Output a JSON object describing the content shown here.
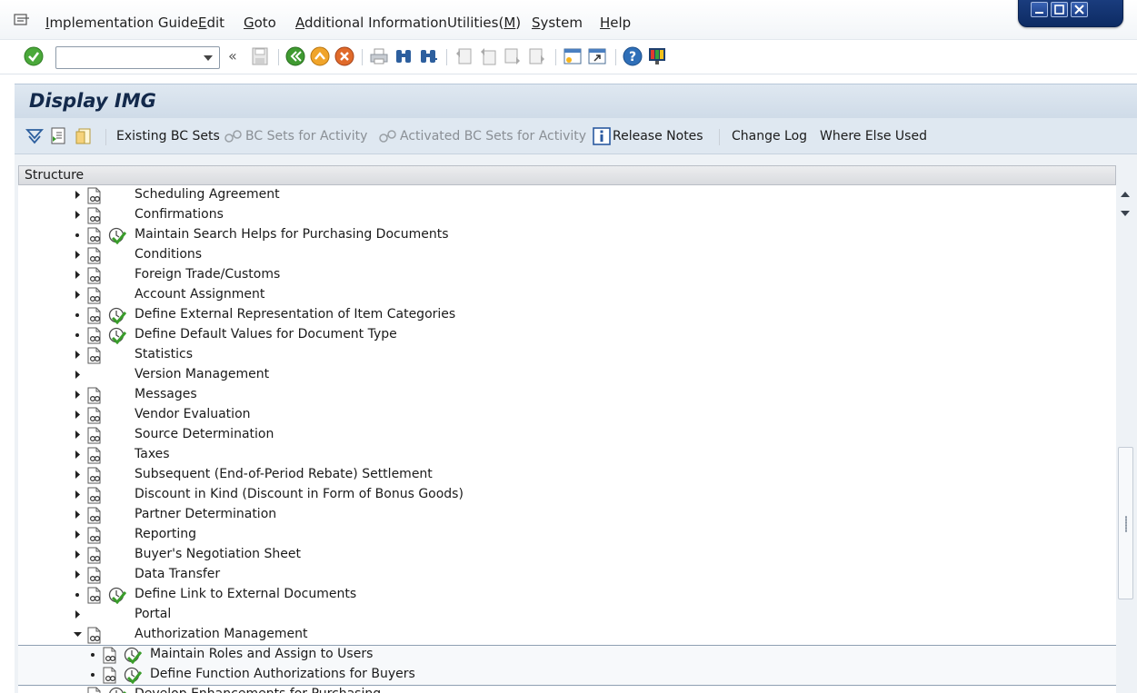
{
  "menubar": {
    "items": [
      {
        "pre": "",
        "ul": "I",
        "post": "mplementation Guide"
      },
      {
        "pre": "",
        "ul": "E",
        "post": "dit"
      },
      {
        "pre": "",
        "ul": "G",
        "post": "oto"
      },
      {
        "pre": "",
        "ul": "A",
        "post": "dditional Information"
      },
      {
        "pre": "",
        "ul": "",
        "post": "Utilities(M)"
      },
      {
        "pre": "",
        "ul": "S",
        "post": "ystem"
      },
      {
        "pre": "",
        "ul": "H",
        "post": "elp"
      }
    ],
    "utilities_pre": "Utilities(",
    "utilities_ul": "M",
    "utilities_post": ")"
  },
  "toolbar": {
    "command_field": {
      "value": "",
      "placeholder": ""
    },
    "back_chevrons": "«"
  },
  "title": "Display IMG",
  "app_toolbar": {
    "existing_bc_sets": "Existing BC Sets",
    "bc_sets_for_activity": "BC Sets for Activity",
    "activated_bc_sets": "Activated BC Sets for Activity",
    "release_notes": "Release Notes",
    "change_log": "Change Log",
    "where_else_used": "Where Else Used"
  },
  "tree": {
    "header": "Structure",
    "rows": [
      {
        "label": "Scheduling Agreement",
        "node": "folder",
        "exec": false,
        "doc": true
      },
      {
        "label": "Confirmations",
        "node": "folder",
        "exec": false,
        "doc": true
      },
      {
        "label": "Maintain Search Helps for Purchasing Documents",
        "node": "leaf",
        "exec": true,
        "doc": true
      },
      {
        "label": "Conditions",
        "node": "folder",
        "exec": false,
        "doc": true
      },
      {
        "label": "Foreign Trade/Customs",
        "node": "folder",
        "exec": false,
        "doc": true
      },
      {
        "label": "Account Assignment",
        "node": "folder",
        "exec": false,
        "doc": true
      },
      {
        "label": "Define External Representation of Item Categories",
        "node": "leaf",
        "exec": true,
        "doc": true
      },
      {
        "label": "Define Default Values for Document Type",
        "node": "leaf",
        "exec": true,
        "doc": true
      },
      {
        "label": "Statistics",
        "node": "folder",
        "exec": false,
        "doc": true
      },
      {
        "label": "Version Management",
        "node": "folder",
        "exec": false,
        "doc": false
      },
      {
        "label": "Messages",
        "node": "folder",
        "exec": false,
        "doc": true
      },
      {
        "label": "Vendor Evaluation",
        "node": "folder",
        "exec": false,
        "doc": true
      },
      {
        "label": "Source Determination",
        "node": "folder",
        "exec": false,
        "doc": true
      },
      {
        "label": "Taxes",
        "node": "folder",
        "exec": false,
        "doc": true
      },
      {
        "label": "Subsequent (End-of-Period Rebate) Settlement",
        "node": "folder",
        "exec": false,
        "doc": true
      },
      {
        "label": "Discount in Kind (Discount in Form of Bonus Goods)",
        "node": "folder",
        "exec": false,
        "doc": true
      },
      {
        "label": "Partner Determination",
        "node": "folder",
        "exec": false,
        "doc": true
      },
      {
        "label": "Reporting",
        "node": "folder",
        "exec": false,
        "doc": true
      },
      {
        "label": "Buyer's Negotiation Sheet",
        "node": "folder",
        "exec": false,
        "doc": true
      },
      {
        "label": "Data Transfer",
        "node": "folder",
        "exec": false,
        "doc": true
      },
      {
        "label": "Define Link to External Documents",
        "node": "leaf",
        "exec": true,
        "doc": true
      },
      {
        "label": "Portal",
        "node": "folder",
        "exec": false,
        "doc": false
      },
      {
        "label": "Authorization Management",
        "node": "open",
        "exec": false,
        "doc": true
      },
      {
        "label": "Maintain Roles and Assign to Users",
        "node": "leaf",
        "exec": true,
        "doc": true,
        "child": true
      },
      {
        "label": "Define Function Authorizations for Buyers",
        "node": "leaf",
        "exec": true,
        "doc": true,
        "child": true
      },
      {
        "label": "Develop Enhancements for Purchasing",
        "node": "leaf",
        "exec": true,
        "doc": true
      }
    ]
  },
  "icons": {
    "menu": "menu-icon",
    "enter": "enter-check-icon",
    "save": "save-icon",
    "back": "back-icon",
    "exit": "exit-icon",
    "cancel": "cancel-icon",
    "print": "print-icon",
    "find": "find-icon",
    "find_next": "find-next-icon",
    "first_page": "first-page-icon",
    "prev_page": "previous-page-icon",
    "next_page": "next-page-icon",
    "last_page": "last-page-icon",
    "new_session": "create-session-icon",
    "shortcut": "create-shortcut-icon",
    "help": "help-icon",
    "layout": "customize-layout-icon"
  },
  "colors": {
    "exec_green": "#3a9c2b",
    "title_bg": "#d6e1ec",
    "window_controls": "#1a3c7e"
  }
}
